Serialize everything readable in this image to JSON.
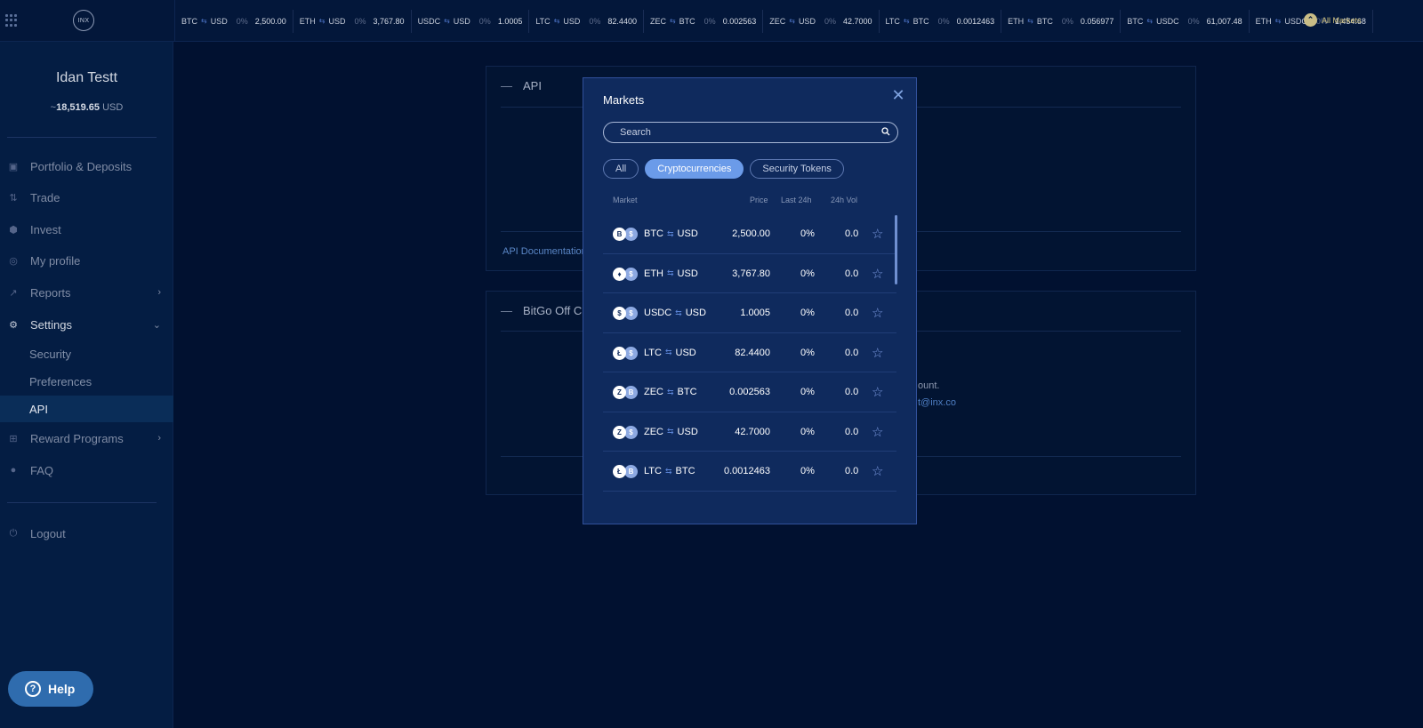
{
  "ticker": [
    {
      "base": "BTC",
      "quote": "USD",
      "change": "0%",
      "price": "2,500.00"
    },
    {
      "base": "ETH",
      "quote": "USD",
      "change": "0%",
      "price": "3,767.80"
    },
    {
      "base": "USDC",
      "quote": "USD",
      "change": "0%",
      "price": "1.0005"
    },
    {
      "base": "LTC",
      "quote": "USD",
      "change": "0%",
      "price": "82.4400"
    },
    {
      "base": "ZEC",
      "quote": "BTC",
      "change": "0%",
      "price": "0.002563"
    },
    {
      "base": "ZEC",
      "quote": "USD",
      "change": "0%",
      "price": "42.7000"
    },
    {
      "base": "LTC",
      "quote": "BTC",
      "change": "0%",
      "price": "0.0012463"
    },
    {
      "base": "ETH",
      "quote": "BTC",
      "change": "0%",
      "price": "0.056977"
    },
    {
      "base": "BTC",
      "quote": "USDC",
      "change": "0%",
      "price": "61,007.48"
    },
    {
      "base": "ETH",
      "quote": "USDC",
      "change": "0%",
      "price": "1,454.68"
    }
  ],
  "header": {
    "logo_text": "INX",
    "all_markets": "All Markets",
    "swap_symbol": "⇆"
  },
  "sidebar": {
    "user_name": "Idan Testt",
    "balance_prefix": "~",
    "balance_value": "18,519.65",
    "balance_currency": " USD",
    "items": [
      {
        "label": "Portfolio & Deposits",
        "icon": "wallet-icon"
      },
      {
        "label": "Trade",
        "icon": "trade-arrows-icon"
      },
      {
        "label": "Invest",
        "icon": "cube-icon"
      },
      {
        "label": "My profile",
        "icon": "fingerprint-icon"
      },
      {
        "label": "Reports",
        "icon": "chart-line-icon"
      },
      {
        "label": "Settings",
        "icon": "gear-icon"
      }
    ],
    "settings_sub": [
      "Security",
      "Preferences",
      "API"
    ],
    "reward": {
      "label": "Reward Programs",
      "icon": "gift-icon"
    },
    "faq": {
      "label": "FAQ",
      "icon": "help-circle-icon"
    },
    "logout": {
      "label": "Logout",
      "icon": "power-icon"
    }
  },
  "help": {
    "label": "Help"
  },
  "background": {
    "api_title": "API",
    "api_link": "API Documentation",
    "bitgo_title": "BitGo Off Ch",
    "bitgo_text": "ount.",
    "bitgo_link": "t@inx.co"
  },
  "modal": {
    "title": "Markets",
    "search_placeholder": "Search",
    "filters": [
      "All",
      "Cryptocurrencies",
      "Security Tokens"
    ],
    "active_filter": "Cryptocurrencies",
    "columns": {
      "market": "Market",
      "price": "Price",
      "last24": "Last 24h",
      "vol24": "24h Vol"
    },
    "rows": [
      {
        "base": "BTC",
        "quote": "USD",
        "price": "2,500.00",
        "change": "0%",
        "vol": "0.0",
        "base_icon": "B",
        "quote_icon": "$"
      },
      {
        "base": "ETH",
        "quote": "USD",
        "price": "3,767.80",
        "change": "0%",
        "vol": "0.0",
        "base_icon": "♦",
        "quote_icon": "$"
      },
      {
        "base": "USDC",
        "quote": "USD",
        "price": "1.0005",
        "change": "0%",
        "vol": "0.0",
        "base_icon": "$",
        "quote_icon": "$"
      },
      {
        "base": "LTC",
        "quote": "USD",
        "price": "82.4400",
        "change": "0%",
        "vol": "0.0",
        "base_icon": "Ł",
        "quote_icon": "$"
      },
      {
        "base": "ZEC",
        "quote": "BTC",
        "price": "0.002563",
        "change": "0%",
        "vol": "0.0",
        "base_icon": "Z",
        "quote_icon": "B"
      },
      {
        "base": "ZEC",
        "quote": "USD",
        "price": "42.7000",
        "change": "0%",
        "vol": "0.0",
        "base_icon": "Z",
        "quote_icon": "$"
      },
      {
        "base": "LTC",
        "quote": "BTC",
        "price": "0.0012463",
        "change": "0%",
        "vol": "0.0",
        "base_icon": "Ł",
        "quote_icon": "B"
      }
    ],
    "star_symbol": "☆",
    "close_symbol": "✕"
  }
}
